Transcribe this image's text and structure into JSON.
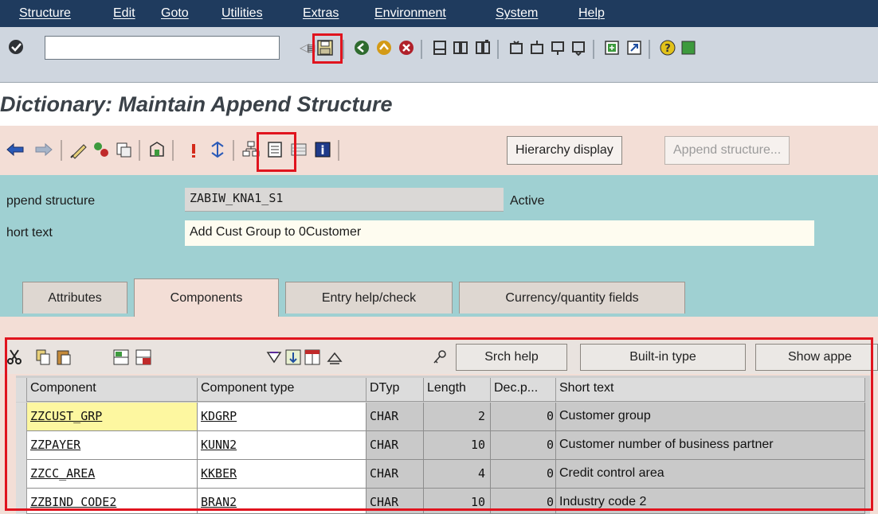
{
  "menu": [
    "Structure",
    "Edit",
    "Goto",
    "Utilities",
    "Extras",
    "Environment",
    "System",
    "Help"
  ],
  "system_toolbar": {
    "command_field_value": "",
    "icons": [
      "enter-check-icon",
      "command-dropdown-icon",
      "save-icon",
      "back-icon",
      "exit-icon",
      "cancel-icon",
      "print-icon",
      "find-icon",
      "find-next-icon",
      "first-page-icon",
      "previous-page-icon",
      "next-page-icon",
      "last-page-icon",
      "new-session-icon",
      "shortcut-icon",
      "help-icon"
    ]
  },
  "title": "Dictionary: Maintain Append Structure",
  "app_toolbar": {
    "buttons": {
      "hierarchy_display": "Hierarchy display",
      "append_structure": "Append structure..."
    }
  },
  "header": {
    "append_structure_label": "ppend structure",
    "append_structure_value": "ZABIW_KNA1_S1",
    "status": "Active",
    "short_text_label": "hort text",
    "short_text_value": "Add Cust Group to 0Customer"
  },
  "tabs": [
    {
      "label": "Attributes",
      "active": false
    },
    {
      "label": "Components",
      "active": true
    },
    {
      "label": "Entry help/check",
      "active": false
    },
    {
      "label": "Currency/quantity fields",
      "active": false
    }
  ],
  "table_toolbar": {
    "srch_help": "Srch help",
    "builtin_type": "Built-in type",
    "show_append": "Show appe"
  },
  "table": {
    "columns": [
      "Component",
      "Component type",
      "DTyp",
      "Length",
      "Dec.p...",
      "Short text"
    ],
    "rows": [
      {
        "component": "ZZCUST_GRP",
        "component_type": "KDGRP",
        "dtyp": "CHAR",
        "length": "2",
        "decimals": "0",
        "short_text": "Customer group"
      },
      {
        "component": "ZZPAYER",
        "component_type": "KUNN2",
        "dtyp": "CHAR",
        "length": "10",
        "decimals": "0",
        "short_text": "Customer number of business partner"
      },
      {
        "component": "ZZCC_AREA",
        "component_type": "KKBER",
        "dtyp": "CHAR",
        "length": "4",
        "decimals": "0",
        "short_text": "Credit control area"
      },
      {
        "component": "ZZBIND_CODE2",
        "component_type": "BRAN2",
        "dtyp": "CHAR",
        "length": "10",
        "decimals": "0",
        "short_text": "Industry code 2"
      }
    ]
  },
  "colors": {
    "menubar": "#1f3b5e",
    "header_area": "#9fd0d2",
    "app_toolbar": "#f3ded6",
    "highlight": "#e0141e"
  }
}
